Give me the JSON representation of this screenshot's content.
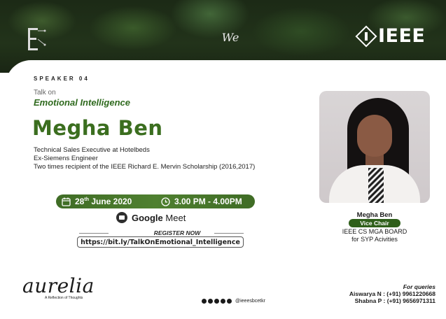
{
  "header": {
    "wie_logo_text": "We",
    "ieee_text": "IEEE"
  },
  "speaker_number": "SPEAKER 04",
  "talk": {
    "prefix": "Talk on",
    "title": "Emotional Intelligence"
  },
  "speaker": {
    "name": "Megha Ben",
    "bio": [
      "Technical Sales Executive at Hotelbeds",
      "Ex-Siemens Engineer",
      "Two times recipient of the IEEE Richard E. Mervin Scholarship (2016,2017)"
    ]
  },
  "event": {
    "date_day": "28",
    "date_suffix": "th",
    "date_rest": "June 2020",
    "time": "3.00 PM - 4.00PM",
    "platform_bold": "Google",
    "platform_rest": "Meet",
    "register_label": "REGISTER NOW",
    "register_link": "https://bit.ly/TalkOnEmotional_Intelligence"
  },
  "photo_card": {
    "name": "Megha Ben",
    "role": "Vice Chair",
    "org_line1": "IEEE CS MGA BOARD",
    "org_line2": "for SYP Acivities"
  },
  "footer": {
    "brand": "aurelia",
    "brand_tag": "A Reflection of Thoughts",
    "social_handle": "@ieeesbcetkr",
    "queries_title": "For queries",
    "contacts": [
      "Aiswarya N : (+91) 9961220668",
      "Shabna P : (+91) 9656971311"
    ]
  },
  "colors": {
    "accent_green": "#3b6e1f",
    "pill_green": "#2f5f1a"
  }
}
